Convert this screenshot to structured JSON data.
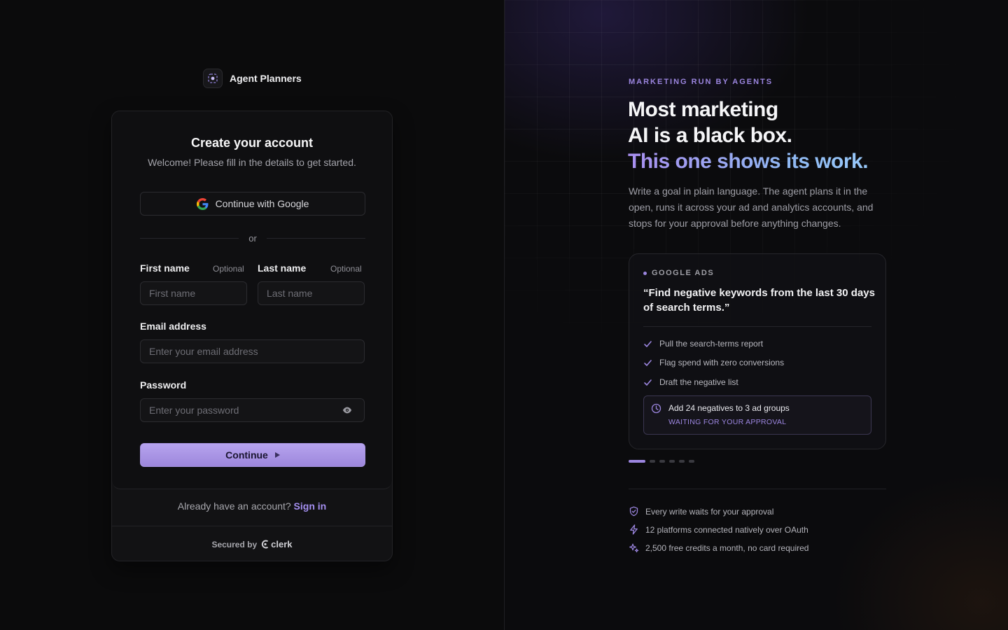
{
  "brand": {
    "name": "Agent Planners"
  },
  "signup": {
    "title": "Create your account",
    "subtitle": "Welcome! Please fill in the details to get started.",
    "google_label": "Continue with Google",
    "divider": "or",
    "first_name": {
      "label": "First name",
      "optional": "Optional",
      "placeholder": "First name"
    },
    "last_name": {
      "label": "Last name",
      "optional": "Optional",
      "placeholder": "Last name"
    },
    "email": {
      "label": "Email address",
      "placeholder": "Enter your email address"
    },
    "password": {
      "label": "Password",
      "placeholder": "Enter your password"
    },
    "continue_label": "Continue",
    "signin_prompt": "Already have an account?",
    "signin_link": "Sign in",
    "secured_by": "Secured by",
    "secured_brand": "clerk"
  },
  "promo": {
    "eyebrow": "MARKETING RUN BY AGENTS",
    "headline_1": "Most marketing",
    "headline_2": "AI is a black box.",
    "headline_3": "This one shows its work.",
    "description": "Write a goal in plain language. The agent plans it in the open, runs it across your ad and analytics accounts, and stops for your approval before anything changes.",
    "demo": {
      "tag": "GOOGLE ADS",
      "quote": "“Find negative keywords from the last 30 days of search terms.”",
      "steps": [
        "Pull the search-terms report",
        "Flag spend with zero conversions",
        "Draft the negative list"
      ],
      "approval_text": "Add 24 negatives to 3 ad groups",
      "approval_status": "WAITING FOR YOUR APPROVAL"
    },
    "pager": {
      "active_index": 0,
      "count": 6
    },
    "features": [
      {
        "icon": "shield-check-icon",
        "text": "Every write waits for your approval"
      },
      {
        "icon": "lightning-icon",
        "text": "12 platforms connected natively over OAuth"
      },
      {
        "icon": "sparkles-icon",
        "text": "2,500 free credits a month, no card required"
      }
    ]
  },
  "colors": {
    "accent": "#9c86e0",
    "button": "#b6a3ee",
    "background": "#0b0b0c"
  }
}
